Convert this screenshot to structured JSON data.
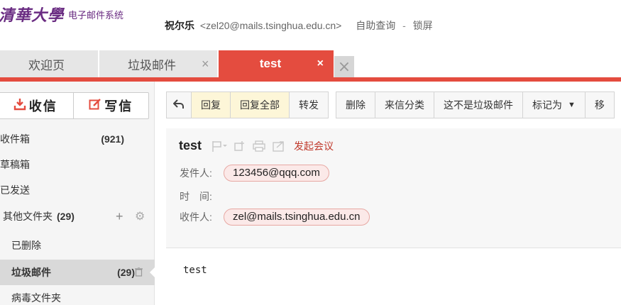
{
  "logo": {
    "name": "清華大學",
    "subtitle": "电子邮件系统"
  },
  "user": {
    "name": "祝尔乐",
    "email": "<zel20@mails.tsinghua.edu.cn>",
    "query_link": "自助查询",
    "separator": "-",
    "lock_link": "锁屏"
  },
  "tabs": [
    {
      "label": "欢迎页",
      "active": false,
      "closable": false
    },
    {
      "label": "垃圾邮件",
      "active": false,
      "closable": true,
      "close_glyph": "×"
    },
    {
      "label": "test",
      "active": true,
      "closable": true,
      "close_glyph": "×"
    }
  ],
  "tabs_close_all_glyph": "×",
  "compose": {
    "receive_label": "收信",
    "write_label": "写信"
  },
  "folders": {
    "inbox": {
      "label": "收件箱",
      "count": "(921)"
    },
    "drafts": {
      "label": "草稿箱"
    },
    "sent": {
      "label": "已发送"
    },
    "other": {
      "label": "其他文件夹",
      "count": "(29)"
    },
    "deleted": {
      "label": "已删除"
    },
    "junk": {
      "label": "垃圾邮件",
      "count": "(29)",
      "selected": true
    },
    "virus": {
      "label": "病毒文件夹"
    }
  },
  "toolbar": {
    "reply": "回复",
    "reply_all": "回复全部",
    "forward": "转发",
    "delete": "删除",
    "classify": "来信分类",
    "not_spam": "这不是垃圾邮件",
    "mark_as": "标记为",
    "more_partial": "移"
  },
  "mail": {
    "subject": "test",
    "meeting_link": "发起会议",
    "from_label": "发件人:",
    "from_value": "123456@qqq.com",
    "time_label": "时　间:",
    "time_value": "",
    "to_label": "收件人:",
    "to_value": "zel@mails.tsinghua.edu.cn",
    "body": "test"
  },
  "colors": {
    "accent": "#e44c3f",
    "brand": "#6a2c82",
    "pill_bg": "#fbe9e8",
    "pill_border": "#e7a8a3",
    "toolbar_highlight": "#fdf6d8"
  },
  "icons": [
    "back-arrow-icon",
    "flag-icon",
    "tag-icon",
    "print-icon",
    "forward-window-icon",
    "trash-icon",
    "plus-icon",
    "gear-icon",
    "inbox-download-icon",
    "pencil-icon",
    "close-icon"
  ]
}
